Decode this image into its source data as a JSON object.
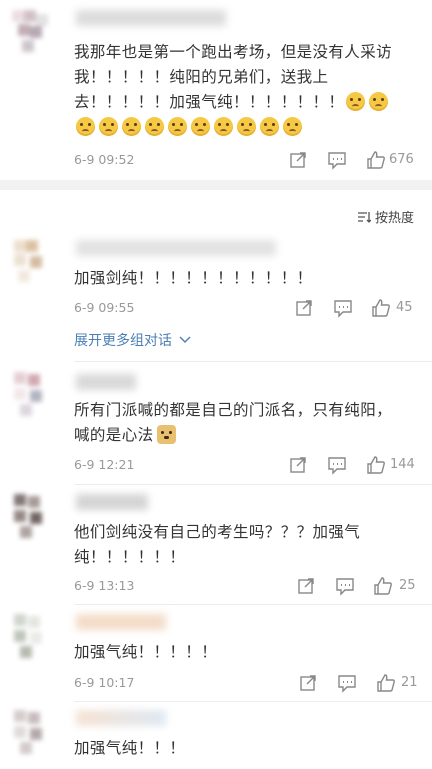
{
  "top_comment": {
    "text": "我那年也是第一个跑出考场，但是没有人采访我！！！！！纯阳的兄弟们，送我上去！！！！！加强气纯！！！！！！！",
    "emoji_name": "sad-face-emoji",
    "time": "6-9 09:52",
    "likes": "676"
  },
  "sort_label": "按热度",
  "comments": [
    {
      "text": "加强剑纯！！！！！！！！！！！",
      "time": "6-9 09:55",
      "likes": "45",
      "expand_label": "展开更多组对话"
    },
    {
      "text": "所有门派喊的都是自己的门派名，只有纯阳，喊的是心法",
      "emoji_name": "doge-emoji",
      "time": "6-9 12:21",
      "likes": "144"
    },
    {
      "text": "他们剑纯没有自己的考生吗？？？加强气纯！！！！！！",
      "time": "6-9 13:13",
      "likes": "25"
    },
    {
      "text": "加强气纯！！！！！",
      "time": "6-9 10:17",
      "likes": "21"
    },
    {
      "text": "加强气纯！！！"
    }
  ],
  "colors": {
    "link": "#4a7fb3",
    "meta": "#999999",
    "separator": "#f2f2f2"
  }
}
